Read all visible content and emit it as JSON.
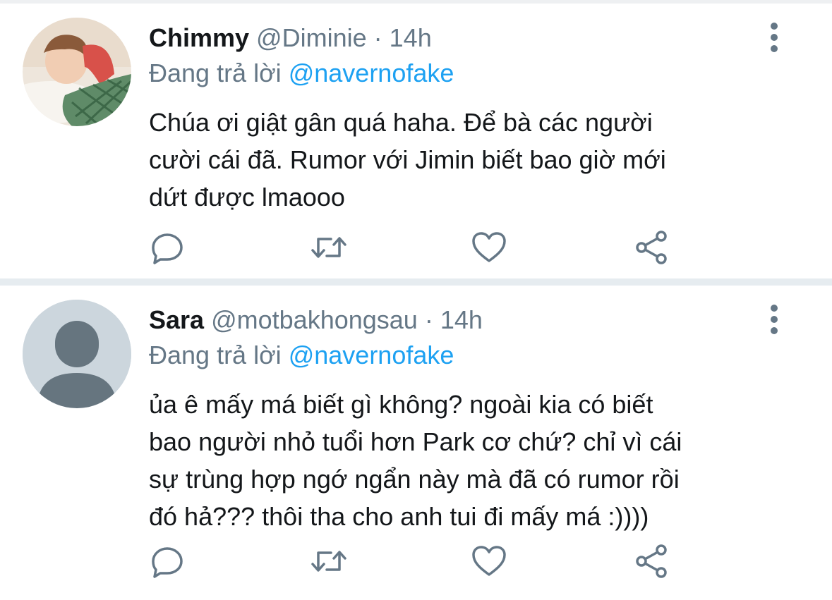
{
  "tweets": [
    {
      "name": "Chimmy",
      "handle": "@Diminie",
      "separator": "·",
      "time": "14h",
      "reply_prefix": "Đang trả lời",
      "reply_to": "@navernofake",
      "text_lines": [
        "Chúa ơi giật gân quá haha. Để bà các người",
        "cười cái đã. Rumor với Jimin biết bao giờ mới",
        "dứt được lmaooo"
      ],
      "avatar_icon": "user-photo-avatar"
    },
    {
      "name": "Sara",
      "handle": "@motbakhongsau",
      "separator": "·",
      "time": "14h",
      "reply_prefix": "Đang trả lời",
      "reply_to": "@navernofake",
      "text_lines": [
        "ủa ê mấy má biết gì không? ngoài kia có biết",
        "bao người nhỏ tuổi hơn Park cơ chứ? chỉ vì cái",
        "sự trùng hợp ngớ ngẩn này mà đã có rumor rồi",
        "đó hả??? thôi tha cho anh tui đi mấy má :))))"
      ],
      "avatar_icon": "default-profile-avatar"
    }
  ],
  "icons": {
    "more": "more-vertical-icon",
    "reply": "reply-bubble-icon",
    "retweet": "retweet-icon",
    "like": "heart-icon",
    "share": "share-icon"
  },
  "colors": {
    "text": "#14171a",
    "secondary": "#657786",
    "link": "#1da1f2",
    "divider": "#e6ecf0"
  }
}
